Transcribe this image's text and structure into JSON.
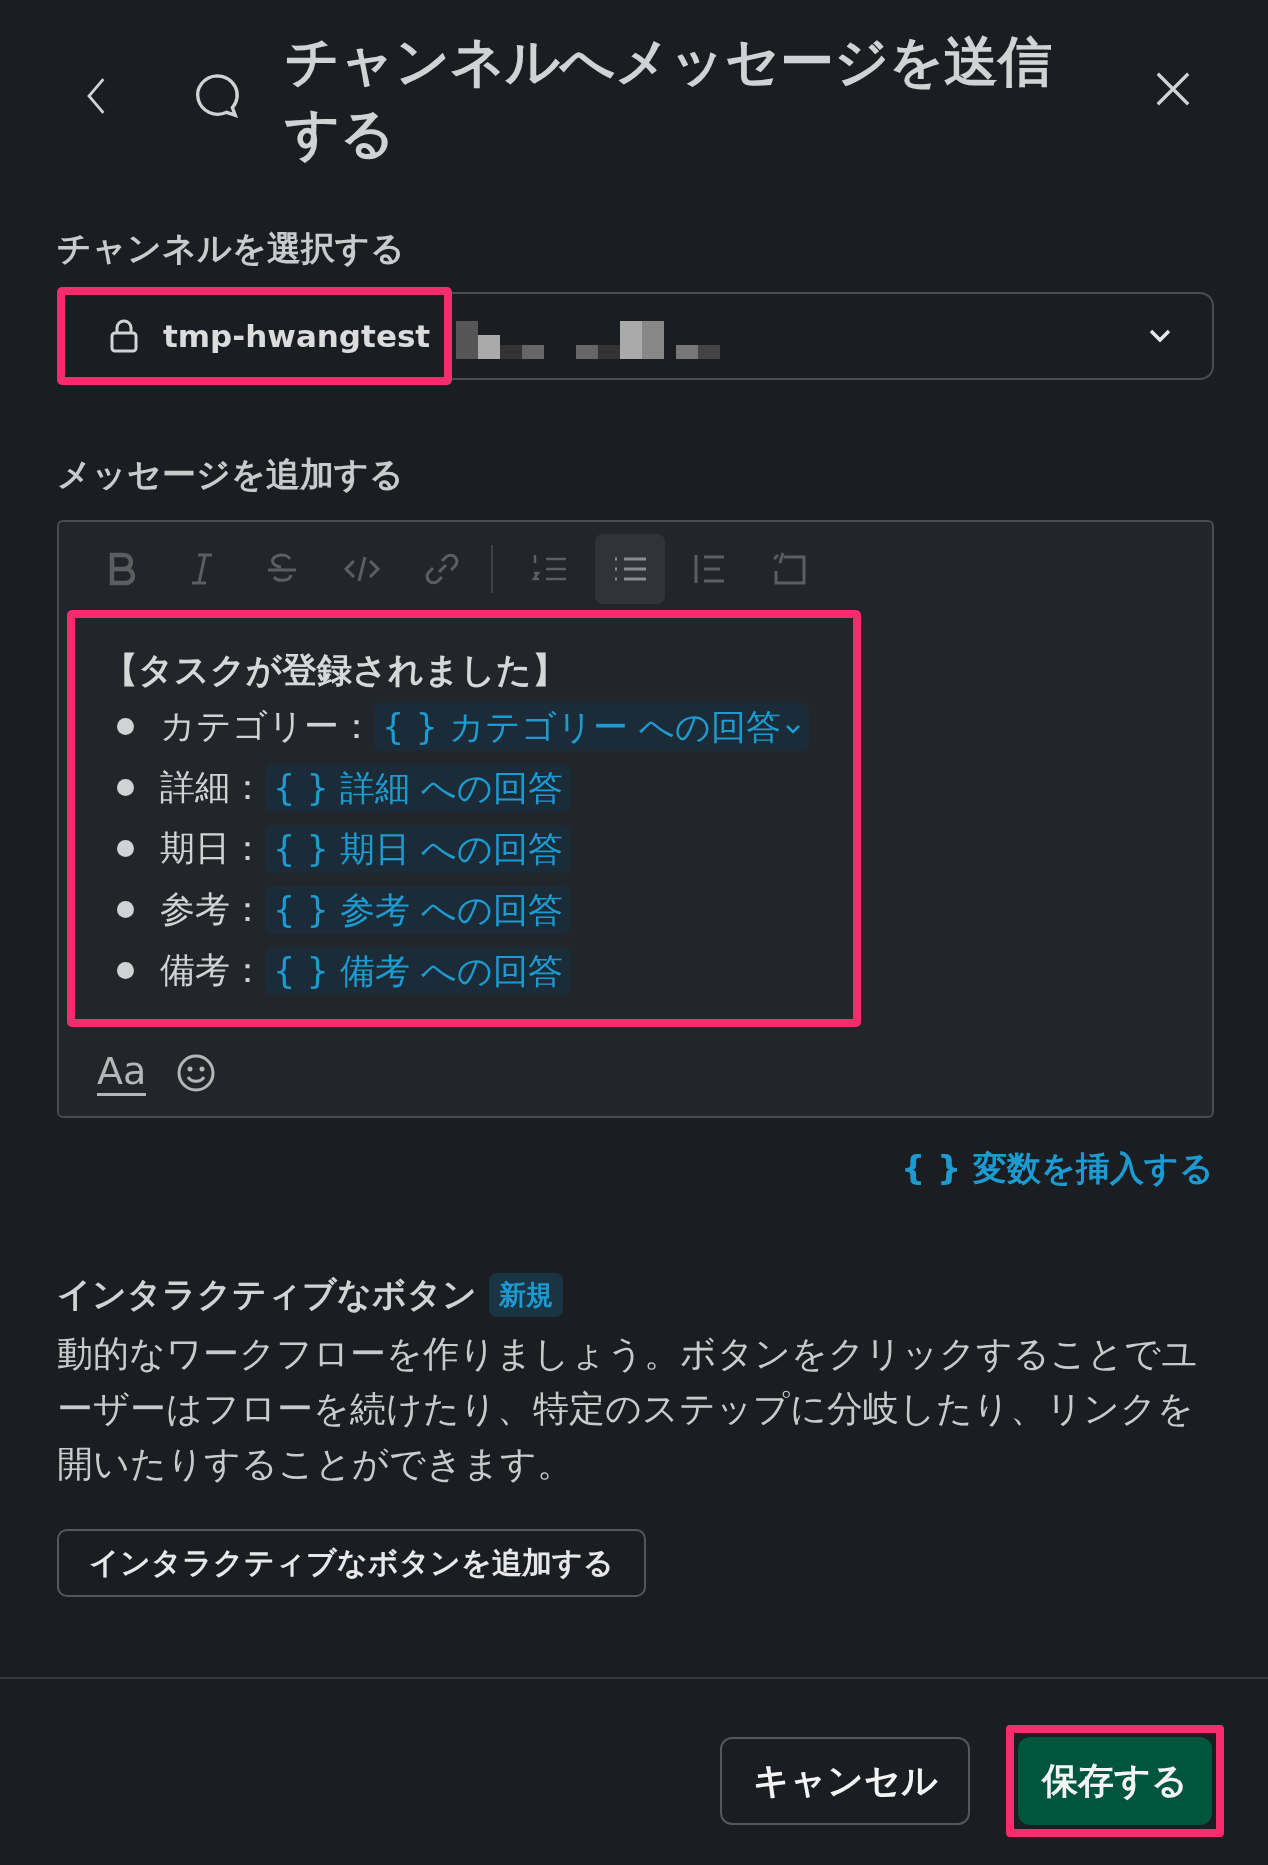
{
  "header": {
    "title": "チャンネルへメッセージを送信する"
  },
  "channel_select": {
    "label": "チャンネルを選択する",
    "value": "tmp-hwangtest",
    "highlighted": true
  },
  "message": {
    "label": "メッセージを追加する",
    "highlighted": true,
    "toolbar": [
      {
        "kind": "bold",
        "selected": false
      },
      {
        "kind": "italic",
        "selected": false
      },
      {
        "kind": "strike",
        "selected": false
      },
      {
        "kind": "code",
        "selected": false
      },
      {
        "kind": "link",
        "selected": false
      },
      {
        "kind": "ordered",
        "selected": false
      },
      {
        "kind": "bulleted",
        "selected": true
      },
      {
        "kind": "quote",
        "selected": false
      },
      {
        "kind": "codeblock",
        "selected": false
      }
    ],
    "heading": "【タスクが登録されました】",
    "items": [
      {
        "label": "カテゴリー：",
        "variable": "{ } カテゴリー への回答",
        "dropdown": true
      },
      {
        "label": "詳細：",
        "variable": "{ } 詳細 への回答",
        "dropdown": false
      },
      {
        "label": "期日：",
        "variable": "{ } 期日 への回答",
        "dropdown": false
      },
      {
        "label": "参考：",
        "variable": "{ } 参考 への回答",
        "dropdown": false
      },
      {
        "label": "備考：",
        "variable": "{ } 備考 への回答",
        "dropdown": false
      }
    ],
    "format_label": "Aa"
  },
  "insert_variable": "{ } 変数を挿入する",
  "interactive": {
    "title": "インタラクティブなボタン",
    "badge": "新規",
    "description": "動的なワークフローを作りましょう。ボタンをクリックすることでユーザーはフローを続けたり、特定のステップに分岐したり、リンクを開いたりすることができます。",
    "add_button": "インタラクティブなボタンを追加する"
  },
  "footer": {
    "buttons": [
      {
        "label": "キャンセル",
        "kind": "secondary",
        "highlighted": false
      },
      {
        "label": "保存する",
        "kind": "primary",
        "highlighted": true
      }
    ]
  }
}
